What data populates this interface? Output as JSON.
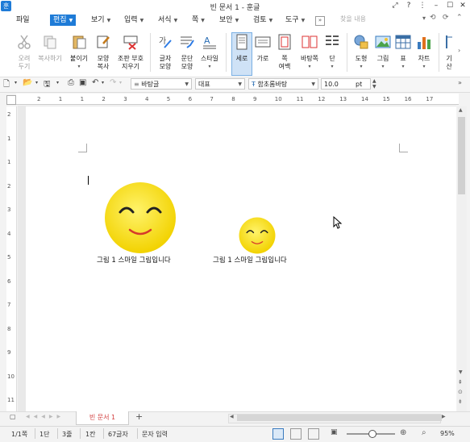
{
  "window": {
    "title": "빈 문서 1 - 훈글",
    "app_logo": "훈"
  },
  "menu": {
    "file": "파일",
    "items": [
      {
        "label": "편집",
        "active": true
      },
      {
        "label": "보기"
      },
      {
        "label": "입력"
      },
      {
        "label": "서식"
      },
      {
        "label": "쪽"
      },
      {
        "label": "보안"
      },
      {
        "label": "검토"
      },
      {
        "label": "도구"
      }
    ],
    "more": "»",
    "search_placeholder": "찾을 내용"
  },
  "ribbon": {
    "cut": "오려\n두기",
    "copy": "복사하기",
    "paste": "붙이기",
    "format_copy": "모양\n복사",
    "clear_format": "조판 부호\n지우기",
    "char_shape": "글자\n모양",
    "para_shape": "문단\n모양",
    "style": "스타일",
    "portrait": "세로",
    "landscape": "가로",
    "margins": "쪽\n여백",
    "background": "바탕쪽",
    "columns": "단",
    "shapes": "도형",
    "picture": "그림",
    "table": "표",
    "chart": "차트",
    "more_right": "기\n산"
  },
  "format_bar": {
    "style_name": "바탕글",
    "lang": "대표",
    "font": "함초롬바탕",
    "font_size": "10.0",
    "unit": "pt"
  },
  "ruler": {
    "h_ticks": [
      "2",
      "1",
      "1",
      "2",
      "3",
      "4",
      "5",
      "6",
      "7",
      "8",
      "9",
      "10",
      "11",
      "12",
      "13",
      "14",
      "15",
      "16",
      "17"
    ],
    "v_ticks": [
      "2",
      "1",
      "1",
      "2",
      "3",
      "4",
      "5",
      "6",
      "7",
      "8",
      "9",
      "10",
      "11"
    ]
  },
  "document": {
    "images": [
      {
        "caption": "그림 1  스마일 그림입니다"
      },
      {
        "caption": "그림 1  스마일 그림입니다"
      }
    ],
    "smiley_color": "#f7e400"
  },
  "tabs": {
    "doc_tab": "빈 문서 1",
    "add": "+"
  },
  "status": {
    "page": "1/1쪽",
    "section": "1단",
    "line": "3줄",
    "col": "1칸",
    "chars": "67글자",
    "mode": "문자 입력",
    "zoom": "95%"
  }
}
